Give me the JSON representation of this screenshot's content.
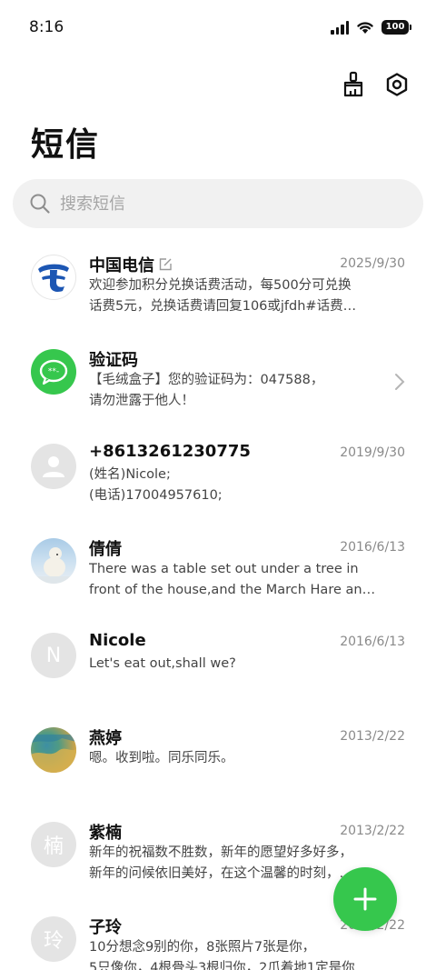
{
  "status_bar": {
    "time": "8:16",
    "battery": "100"
  },
  "header": {
    "title": "短信"
  },
  "search": {
    "placeholder": "搜索短信"
  },
  "conversations": [
    {
      "name": "中国电信",
      "date": "2025/9/30",
      "line1": "欢迎参加积分兑换话费活动，每500分可兑换",
      "line2": "话费5元，兑换话费请回复106或jfdh#话费…"
    },
    {
      "name": "验证码",
      "date": "",
      "line1": "【毛绒盒子】您的验证码为：047588，",
      "line2": "请勿泄露于他人！"
    },
    {
      "name": "+8613261230775",
      "date": "2019/9/30",
      "line1": "(姓名)Nicole;",
      "line2": "(电话)17004957610;"
    },
    {
      "name": "倩倩",
      "date": "2016/6/13",
      "line1": "There was a table set out under a tree in",
      "line2": "front of the house,and the March Hare an…"
    },
    {
      "name": "Nicole",
      "date": "2016/6/13",
      "avatar_letter": "N",
      "line1": "Let's eat out,shall we?",
      "line2": ""
    },
    {
      "name": "燕婷",
      "date": "2013/2/22",
      "line1": "嗯。收到啦。同乐同乐。",
      "line2": ""
    },
    {
      "name": "紫楠",
      "date": "2013/2/22",
      "avatar_letter": "楠",
      "line1": "新年的祝福数不胜数，新年的愿望好多好多，",
      "line2": "新年的问候依旧美好，在这个温馨的时刻，…"
    },
    {
      "name": "子玲",
      "date": "2013/2/22",
      "avatar_letter": "玲",
      "line1": "10分想念9别的你，8张照片7张是你，",
      "line2": "5只像你，4根骨头3根归你，2爪着地1定是你…"
    }
  ],
  "colors": {
    "accent_green": "#36c74d",
    "telecom_blue": "#1c56b3"
  }
}
